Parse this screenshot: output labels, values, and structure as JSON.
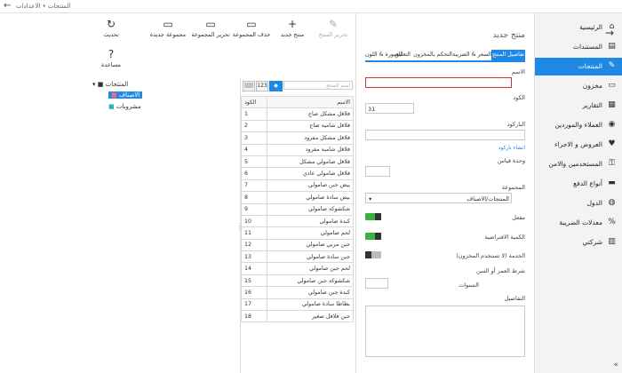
{
  "window": {
    "title": "المنتجات • الاعدادات",
    "back": "←"
  },
  "sidebar": {
    "items": [
      {
        "label": "الرئيسية",
        "icon": "⌂",
        "active": false
      },
      {
        "label": "المستندات",
        "icon": "▤",
        "active": false
      },
      {
        "label": "المنتجات",
        "icon": "✎",
        "active": true
      },
      {
        "label": "مخزون",
        "icon": "▭",
        "active": false
      },
      {
        "label": "التقارير",
        "icon": "▦",
        "active": false
      },
      {
        "label": "العملاء والموردين",
        "icon": "◉",
        "active": false
      },
      {
        "label": "العروض و الاجراء",
        "icon": "♥",
        "active": false
      },
      {
        "label": "المستخدمين والامن",
        "icon": "⚿",
        "active": false
      },
      {
        "label": "أنواع الدفع",
        "icon": "▬",
        "active": false
      },
      {
        "label": "الدول",
        "icon": "◍",
        "active": false
      },
      {
        "label": "معدلات الضريبة",
        "icon": "%",
        "active": false
      },
      {
        "label": "شركتي",
        "icon": "▥",
        "active": false
      }
    ],
    "collapse": "«"
  },
  "toolbar": {
    "buttons": [
      {
        "label": "تحرير المنتج",
        "icon": "✎",
        "disabled": true
      },
      {
        "label": "منتج جديد",
        "icon": "+",
        "disabled": false
      },
      {
        "label": "حذف المجموعة",
        "icon": "▭",
        "disabled": false
      },
      {
        "label": "تحرير المجموعة",
        "icon": "▭",
        "disabled": false
      },
      {
        "label": "مجموعة جديدة",
        "icon": "▭",
        "disabled": false
      },
      {
        "label": "تحديث",
        "icon": "↻",
        "disabled": false
      },
      {
        "label": "مساعدة",
        "icon": "?",
        "disabled": false
      }
    ]
  },
  "tree": {
    "root": "المنتجات",
    "children": [
      {
        "label": "الاصناف",
        "selected": true
      },
      {
        "label": "مشروبات",
        "selected": false
      }
    ]
  },
  "grid": {
    "search_placeholder": "اسم المنتج",
    "filter_label": "123",
    "barcode_label": "|||||",
    "headers": {
      "code": "الكود",
      "name": "الاسم"
    },
    "rows": [
      {
        "code": "1",
        "name": "فلافل مشكل صاج"
      },
      {
        "code": "2",
        "name": "فلافل شامية صاج"
      },
      {
        "code": "3",
        "name": "فلافل مشكل مفرود"
      },
      {
        "code": "4",
        "name": "فلافل شامية مفرود"
      },
      {
        "code": "5",
        "name": "فلافل صامولي مشكل"
      },
      {
        "code": "6",
        "name": "فلافل صامولي عادي"
      },
      {
        "code": "7",
        "name": "بيض جبن صامولي"
      },
      {
        "code": "8",
        "name": "بيض سادة صامولي"
      },
      {
        "code": "9",
        "name": "شكشوكة صامولي"
      },
      {
        "code": "10",
        "name": "كبدة صامولي"
      },
      {
        "code": "11",
        "name": "لحم صامولي"
      },
      {
        "code": "12",
        "name": "جبن مربي صامولي"
      },
      {
        "code": "13",
        "name": "جبن سادة صامولي"
      },
      {
        "code": "14",
        "name": "لحم جبن صامولي"
      },
      {
        "code": "15",
        "name": "شكشوكة جبن صامولي"
      },
      {
        "code": "16",
        "name": "كبدة جبن صامولي"
      },
      {
        "code": "17",
        "name": "بطاطا سادة صامولي"
      },
      {
        "code": "18",
        "name": "جبن فلافل صغير"
      }
    ]
  },
  "form": {
    "title": "منتج جديد",
    "tabs": [
      {
        "label": "تفاصيل المنتج",
        "active": true
      },
      {
        "label": "السعر & الضريبة",
        "active": false
      },
      {
        "label": "التحكم بالمخزون",
        "active": false
      },
      {
        "label": "التعليق",
        "active": false
      },
      {
        "label": "الصورة & اللون",
        "active": false
      }
    ],
    "name_label": "الاسم",
    "name_value": "",
    "code_label": "الكود",
    "code_value": "31",
    "barcode_label": "الباركود",
    "barcode_value": "",
    "barcode_link": "انشاء باركود",
    "unit_label": "وحدة قياس",
    "unit_value": "",
    "group_label": "المجموعة",
    "group_value": "المنتجات/الاصناف",
    "enabled_label": "مفعل",
    "default_qty_label": "الكمية الافتراضية",
    "service_label": "الخدمة (لا تستخدم المخزون)",
    "age_label": "شرط العمر أو السن",
    "years_label": "السنوات",
    "years_value": "",
    "details_label": "التفاصيل",
    "details_value": "",
    "nav_arrow": "→",
    "dropdown_arrow": "▾"
  }
}
